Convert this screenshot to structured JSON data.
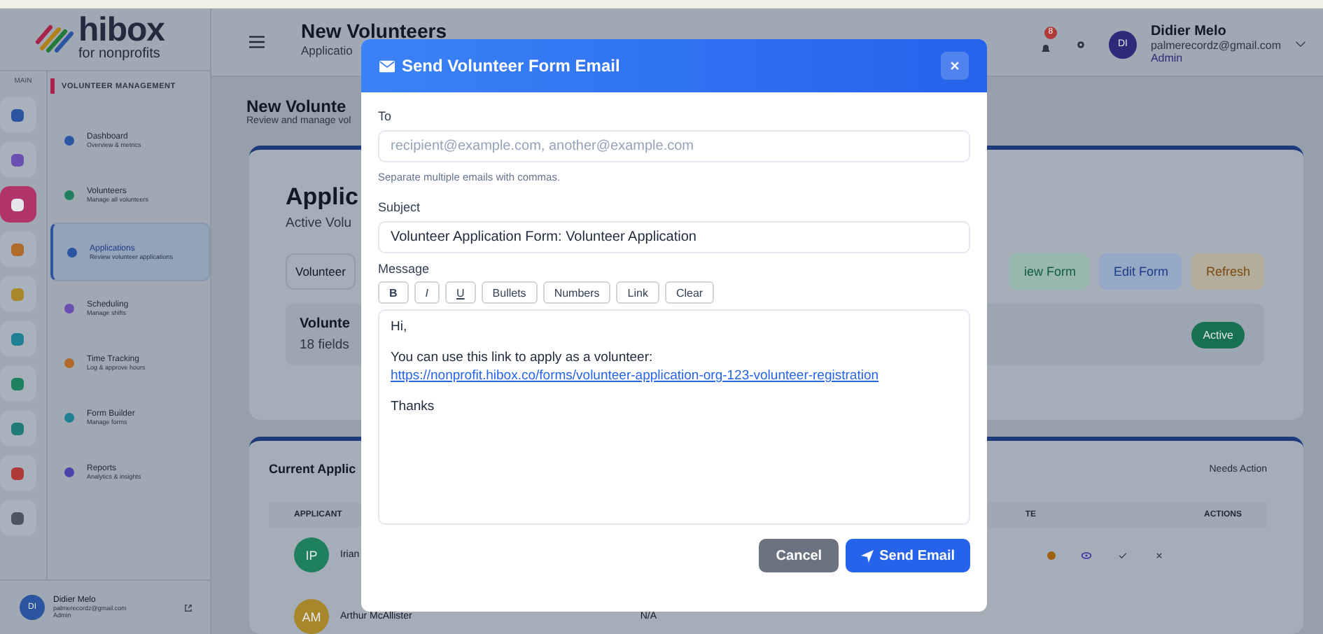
{
  "brand": {
    "name": "hibox",
    "tagline": "for nonprofits"
  },
  "rail": {
    "label": "MAIN",
    "items": [
      {
        "selected": false,
        "color": "#2b55a0"
      },
      {
        "selected": false,
        "color": "#6a4fb0"
      },
      {
        "selected": true,
        "color": "#b0336a"
      },
      {
        "selected": false,
        "color": "#b06a2a"
      },
      {
        "selected": false,
        "color": "#a8862a"
      },
      {
        "selected": false,
        "color": "#1f7f95"
      },
      {
        "selected": false,
        "color": "#1f8060"
      },
      {
        "selected": false,
        "color": "#1f7a78"
      },
      {
        "selected": false,
        "color": "#b03a3a"
      },
      {
        "selected": false,
        "color": "#4b5563"
      }
    ]
  },
  "nav": {
    "section": "VOLUNTEER MANAGEMENT",
    "items": [
      {
        "label": "Dashboard",
        "sub": "Overview & metrics",
        "selected": false,
        "color": "#2b55a0"
      },
      {
        "label": "Volunteers",
        "sub": "Manage all volunteers",
        "selected": false,
        "color": "#1f8060"
      },
      {
        "label": "Applications",
        "sub": "Review volunteer applications",
        "selected": true,
        "color": "#2b55a0"
      },
      {
        "label": "Scheduling",
        "sub": "Manage shifts",
        "selected": false,
        "color": "#6a4fb0"
      },
      {
        "label": "Time Tracking",
        "sub": "Log & approve hours",
        "selected": false,
        "color": "#b06a2a"
      },
      {
        "label": "Form Builder",
        "sub": "Manage forms",
        "selected": false,
        "color": "#1f7f95"
      },
      {
        "label": "Reports",
        "sub": "Analytics & insights",
        "selected": false,
        "color": "#4a44a8"
      }
    ]
  },
  "sidebar_user": {
    "initials": "DI",
    "name": "Didier Melo",
    "email": "palmerecordz@gmail.com",
    "role": "Admin"
  },
  "topbar": {
    "title": "New Volunteers",
    "subtitle": "Applicatio",
    "notification_count": "8",
    "user": {
      "initials": "DI",
      "name": "Didier Melo",
      "email": "palmerecordz@gmail.com",
      "role": "Admin"
    }
  },
  "page": {
    "title": "New Volunte",
    "subtitle": "Review and manage vol"
  },
  "form_card": {
    "title": "Applic",
    "subtitle": "Active Volu",
    "select": "Volunteer",
    "buttons": [
      "iew Form",
      "Edit Form",
      "Refresh"
    ],
    "form_name": "Volunte",
    "fields": "18 fields",
    "status": "Active"
  },
  "applications": {
    "title": "Current Applic",
    "filter": "Needs Action",
    "columns": [
      "APPLICANT",
      "TE",
      "ACTIONS"
    ],
    "rows": [
      {
        "initials": "IP",
        "name": "Irian",
        "color": "#1f8060"
      },
      {
        "initials": "AM",
        "name": "Arthur McAllister",
        "extra": "N/A",
        "color": "#a8862a"
      }
    ]
  },
  "dialog": {
    "title": "Send Volunteer Form Email",
    "to_label": "To",
    "to_placeholder": "recipient@example.com, another@example.com",
    "to_hint": "Separate multiple emails with commas.",
    "subject_label": "Subject",
    "subject": "Volunteer Application Form: Volunteer Application",
    "message_label": "Message",
    "toolbar": [
      {
        "label": "B",
        "kind": "bold"
      },
      {
        "label": "I",
        "kind": "italic"
      },
      {
        "label": "U",
        "kind": "underline"
      },
      {
        "label": "Bullets",
        "kind": "plain"
      },
      {
        "label": "Numbers",
        "kind": "plain"
      },
      {
        "label": "Link",
        "kind": "plain"
      },
      {
        "label": "Clear",
        "kind": "plain"
      }
    ],
    "message": [
      {
        "kind": "text",
        "text": "Hi,"
      },
      {
        "kind": "text",
        "text": "You can use this link to apply as a volunteer:"
      },
      {
        "kind": "link",
        "text": "https://nonprofit.hibox.co/forms/volunteer-application-org-123-volunteer-registration"
      },
      {
        "kind": "text",
        "text": "Thanks"
      }
    ],
    "cancel": "Cancel",
    "send": "Send Email"
  }
}
